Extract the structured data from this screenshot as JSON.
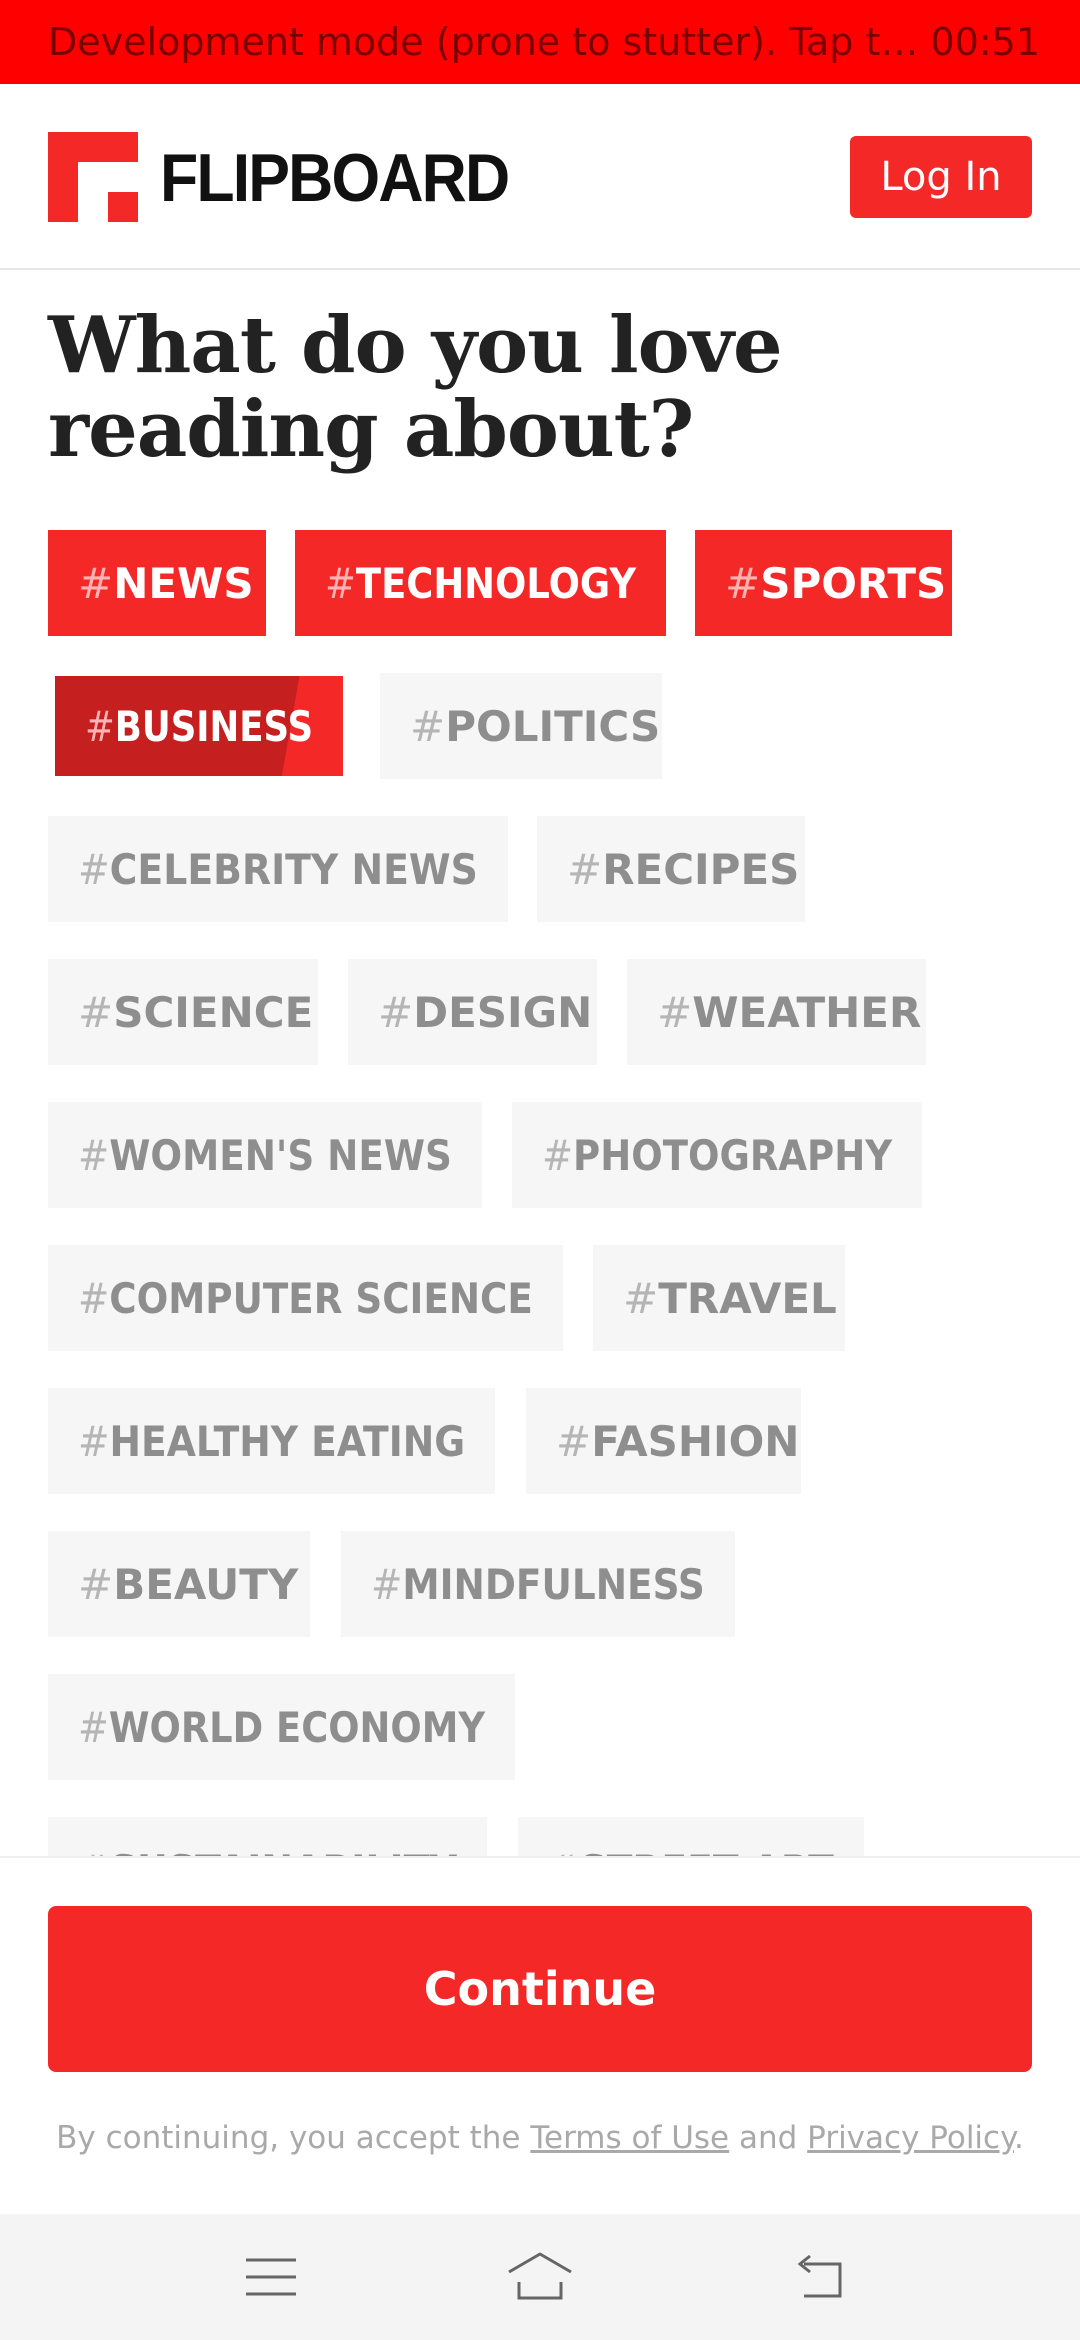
{
  "status_bar": {
    "message": "Development mode (prone to stutter). Tap to …",
    "time": "00:51"
  },
  "header": {
    "brand": "FLIPBOARD",
    "login_label": "Log In"
  },
  "title": "What do you love reading about?",
  "tags": [
    {
      "hash": "#",
      "label": "NEWS",
      "selected": true
    },
    {
      "hash": "#",
      "label": "TECHNOLOGY",
      "selected": true
    },
    {
      "hash": "#",
      "label": "SPORTS",
      "selected": true
    },
    {
      "hash": "#",
      "label": "BUSINESS",
      "selected": true
    },
    {
      "hash": "#",
      "label": "POLITICS",
      "selected": false
    },
    {
      "hash": "#",
      "label": "CELEBRITY NEWS",
      "selected": false
    },
    {
      "hash": "#",
      "label": "RECIPES",
      "selected": false
    },
    {
      "hash": "#",
      "label": "SCIENCE",
      "selected": false
    },
    {
      "hash": "#",
      "label": "DESIGN",
      "selected": false
    },
    {
      "hash": "#",
      "label": "WEATHER",
      "selected": false
    },
    {
      "hash": "#",
      "label": "WOMEN'S NEWS",
      "selected": false
    },
    {
      "hash": "#",
      "label": "PHOTOGRAPHY",
      "selected": false
    },
    {
      "hash": "#",
      "label": "COMPUTER SCIENCE",
      "selected": false
    },
    {
      "hash": "#",
      "label": "TRAVEL",
      "selected": false
    },
    {
      "hash": "#",
      "label": "HEALTHY EATING",
      "selected": false
    },
    {
      "hash": "#",
      "label": "FASHION",
      "selected": false
    },
    {
      "hash": "#",
      "label": "BEAUTY",
      "selected": false
    },
    {
      "hash": "#",
      "label": "MINDFULNESS",
      "selected": false
    },
    {
      "hash": "#",
      "label": "WORLD ECONOMY",
      "selected": false
    },
    {
      "hash": "#",
      "label": "SUSTAINABILITY",
      "selected": false
    },
    {
      "hash": "#",
      "label": "STREET ART",
      "selected": false
    }
  ],
  "footer": {
    "continue_label": "Continue",
    "legal_prefix": "By continuing, you accept the ",
    "terms_label": "Terms of Use",
    "legal_and": " and ",
    "privacy_label": "Privacy Policy",
    "legal_suffix": "."
  },
  "nav": {
    "icons": [
      "menu-icon",
      "home-icon",
      "back-icon"
    ]
  },
  "colors": {
    "accent": "#f52828",
    "dev_bar": "#fe0000",
    "tag_bg": "#f6f6f6",
    "tag_text": "#8e8e8e"
  }
}
